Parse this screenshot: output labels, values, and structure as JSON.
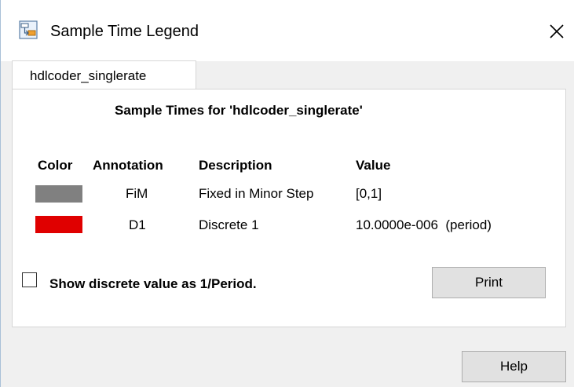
{
  "window": {
    "title": "Sample Time Legend",
    "close_symbol": "×"
  },
  "tab": {
    "label": "hdlcoder_singlerate"
  },
  "panel": {
    "heading": "Sample Times for 'hdlcoder_singlerate'",
    "columns": [
      "Color",
      "Annotation",
      "Description",
      "Value"
    ],
    "rows": [
      {
        "color": "#808080",
        "annotation": "FiM",
        "description": "Fixed in Minor Step",
        "value": "[0,1]"
      },
      {
        "color": "#e00000",
        "annotation": "D1",
        "description": "Discrete 1",
        "value": "10.0000e-006  (period)"
      }
    ],
    "checkbox_label": "Show discrete value as 1/Period.",
    "checkbox_checked": false,
    "print_label": "Print"
  },
  "footer": {
    "help_label": "Help"
  },
  "icons": {
    "app": "simulink-model-icon",
    "close": "close-icon"
  }
}
